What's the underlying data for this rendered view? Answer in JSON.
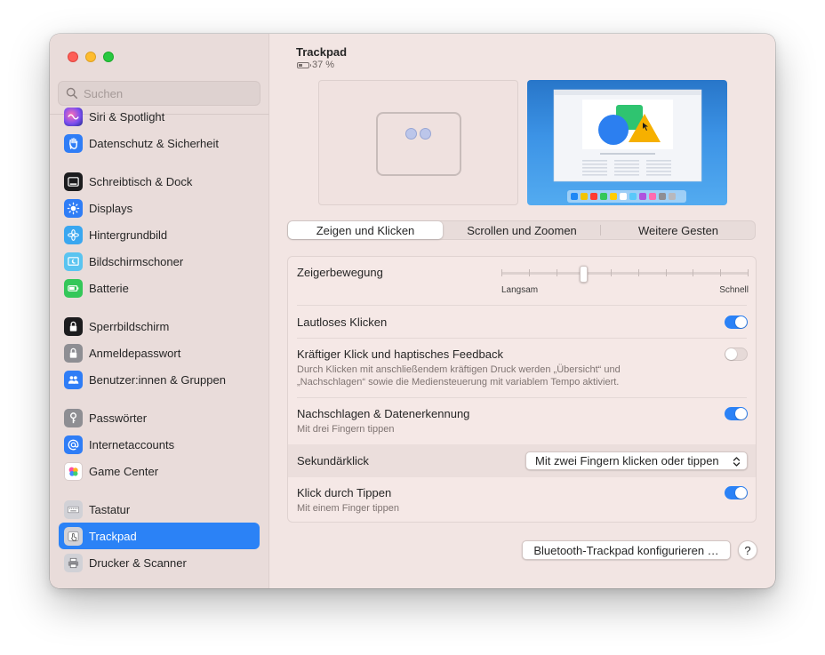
{
  "search": {
    "placeholder": "Suchen"
  },
  "sidebar": {
    "items": [
      {
        "label": "Siri & Spotlight",
        "icon": "siri-icon",
        "color": "#6a4fd8"
      },
      {
        "label": "Datenschutz & Sicherheit",
        "icon": "hand-icon",
        "color": "#2f7df6"
      },
      {
        "label": "Schreibtisch & Dock",
        "icon": "dock-icon",
        "color": "#1c1c1e"
      },
      {
        "label": "Displays",
        "icon": "sun-icon",
        "color": "#2f7df6"
      },
      {
        "label": "Hintergrundbild",
        "icon": "flower-icon",
        "color": "#3aa7f0"
      },
      {
        "label": "Bildschirmschoner",
        "icon": "screensaver-icon",
        "color": "#5ac4f0"
      },
      {
        "label": "Batterie",
        "icon": "battery-icon",
        "color": "#34c759"
      },
      {
        "label": "Sperrbildschirm",
        "icon": "lock-icon",
        "color": "#1c1c1e"
      },
      {
        "label": "Anmeldepasswort",
        "icon": "lock-gray-icon",
        "color": "#8e8e93"
      },
      {
        "label": "Benutzer:innen & Gruppen",
        "icon": "users-icon",
        "color": "#2f7df6"
      },
      {
        "label": "Passwörter",
        "icon": "key-icon",
        "color": "#8e8e93"
      },
      {
        "label": "Internetaccounts",
        "icon": "at-icon",
        "color": "#2f7df6"
      },
      {
        "label": "Game Center",
        "icon": "game-center-icon",
        "color": "#ffffff"
      },
      {
        "label": "Tastatur",
        "icon": "keyboard-icon",
        "color": "#8e8e93"
      },
      {
        "label": "Trackpad",
        "icon": "trackpad-icon",
        "color": "#8e8e93",
        "active": true
      },
      {
        "label": "Drucker & Scanner",
        "icon": "printer-icon",
        "color": "#8e8e93"
      }
    ]
  },
  "header": {
    "title": "Trackpad",
    "battery": "37 %",
    "battery_level": 0.37
  },
  "tabs": [
    {
      "label": "Zeigen und Klicken",
      "selected": true
    },
    {
      "label": "Scrollen und Zoomen",
      "selected": false
    },
    {
      "label": "Weitere Gesten",
      "selected": false
    }
  ],
  "settings": {
    "speed": {
      "label": "Zeigerbewegung",
      "min_label": "Langsam",
      "max_label": "Schnell",
      "value": 3,
      "steps": 10
    },
    "silent": {
      "label": "Lautloses Klicken",
      "on": true
    },
    "force": {
      "label": "Kräftiger Klick und haptisches Feedback",
      "sub": "Durch Klicken mit anschließendem kräftigen Druck werden „Übersicht“ und „Nachschlagen“ sowie die Mediensteuerung mit variablem Tempo aktiviert.",
      "on": false
    },
    "lookup": {
      "label": "Nachschlagen & Datenerkennung",
      "sub": "Mit drei Fingern tippen",
      "on": true
    },
    "secondary": {
      "label": "Sekundärklick",
      "value": "Mit zwei Fingern klicken oder tippen"
    },
    "tap": {
      "label": "Klick durch Tippen",
      "sub": "Mit einem Finger tippen",
      "on": true
    }
  },
  "footer": {
    "bt_button": "Bluetooth-Trackpad konfigurieren …",
    "help": "?"
  },
  "colors": {
    "accent": "#2b82f6",
    "window_bg": "#f2e5e3",
    "sidebar_bg": "#e9dcda"
  }
}
